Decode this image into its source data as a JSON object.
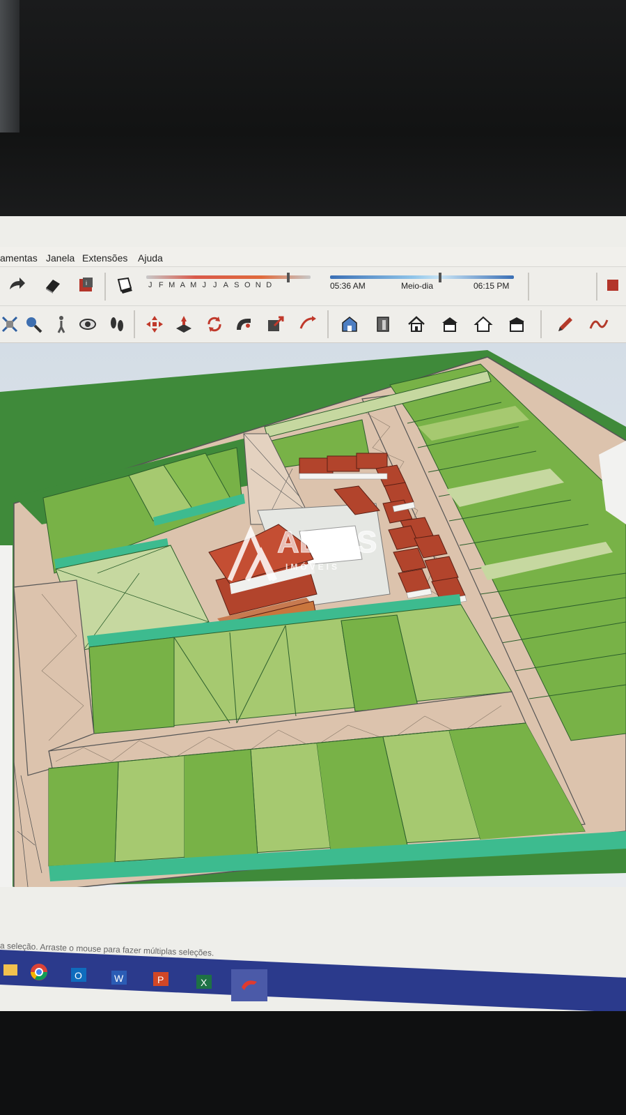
{
  "menu": {
    "items": [
      {
        "label": "amentas"
      },
      {
        "label": "Janela"
      },
      {
        "label": "Extensões"
      },
      {
        "label": "Ajuda"
      }
    ]
  },
  "shadow_settings": {
    "months": [
      "J",
      "F",
      "M",
      "A",
      "M",
      "J",
      "J",
      "A",
      "S",
      "O",
      "N",
      "D"
    ],
    "time_start": "05:36 AM",
    "time_mid": "Meio-dia",
    "time_end": "06:15 PM"
  },
  "toolbar1_icons": [
    "redo-icon",
    "eraser-icon",
    "model-info-icon",
    "shadow-toggle-icon"
  ],
  "toolbar2_icons": [
    "zoom-extents-icon",
    "zoom-icon",
    "walk-icon",
    "look-around-icon",
    "footprints-icon",
    "move-icon",
    "push-pull-icon",
    "rotate-icon",
    "follow-me-icon",
    "scale-icon",
    "offset-icon",
    "iso-view-icon",
    "front-view-icon",
    "house-view-icon",
    "top-view-icon",
    "right-view-icon",
    "back-view-icon",
    "pencil-icon",
    "freehand-icon"
  ],
  "watermark": {
    "brand": "ALVES",
    "sub": "IMÓVEIS"
  },
  "status": {
    "text": "a seleção. Arraste o mouse para fazer múltiplas seleções."
  },
  "taskbar": {
    "apps": [
      "file-explorer-icon",
      "chrome-icon",
      "outlook-icon",
      "word-icon",
      "powerpoint-icon",
      "excel-icon",
      "sketchup-icon"
    ]
  },
  "colors": {
    "grass_dark": "#3f8a3a",
    "grass_mid": "#77b043",
    "grass_light": "#c6d8a0",
    "path": "#dcc3ad",
    "roof": "#b2442c",
    "wall_teal": "#3dbb8f",
    "pool": "#6fd0e6"
  }
}
